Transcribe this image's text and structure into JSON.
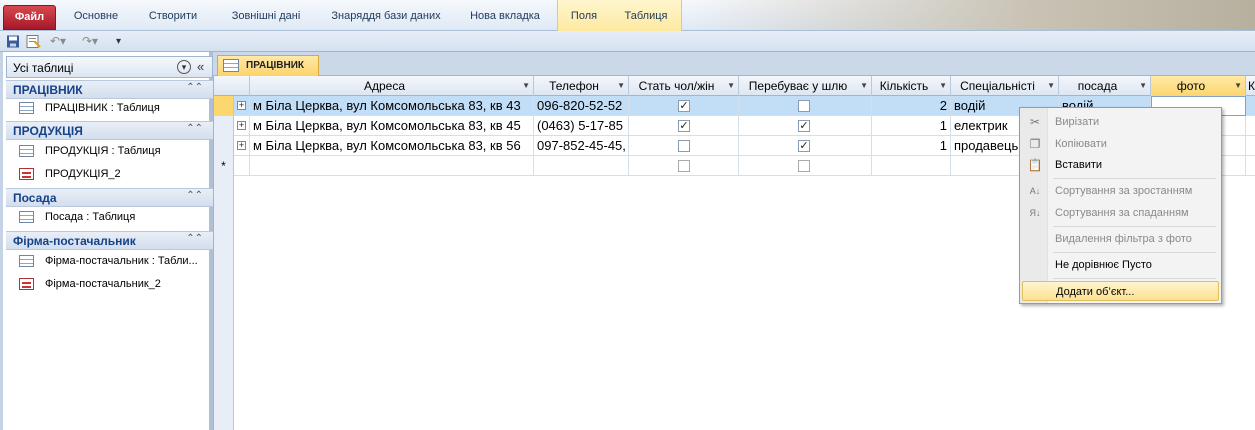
{
  "ribbon": {
    "file_tab": "Файл",
    "tabs": [
      "Основне",
      "Створити",
      "Зовнішні дані",
      "Знаряддя бази даних",
      "Нова вкладка",
      "Поля",
      "Таблиця"
    ]
  },
  "nav": {
    "title": "Усі таблиці",
    "groups": [
      {
        "label": "ПРАЦІВНИК",
        "items": [
          "ПРАЦІВНИК : Таблиця"
        ]
      },
      {
        "label": "ПРОДУКЦІЯ",
        "items": [
          "ПРОДУКЦІЯ : Таблиця",
          "ПРОДУКЦІЯ_2"
        ]
      },
      {
        "label": "Посада",
        "items": [
          "Посада : Таблиця"
        ]
      },
      {
        "label": "Фірма-постачальник",
        "items": [
          "Фірма-постачальник : Табли...",
          "Фірма-постачальник_2"
        ]
      }
    ]
  },
  "document": {
    "tab_label": "ПРАЦІВНИК"
  },
  "table": {
    "columns": [
      "Адреса",
      "Телефон",
      "Стать чол/жін",
      "Перебуває у шлю",
      "Кількість",
      "Спеціальністі",
      "посада",
      "фото",
      "К"
    ],
    "rows": [
      {
        "address": "м Біла Церква, вул Комсомольська 83, кв 43",
        "phone": "096-820-52-52",
        "gender": true,
        "married": false,
        "count": "2",
        "specialty": "водій",
        "position": "водій"
      },
      {
        "address": "м Біла Церква, вул Комсомольська 83, кв 45",
        "phone": "(0463) 5-17-85",
        "gender": true,
        "married": true,
        "count": "1",
        "specialty": "електрик",
        "position": ""
      },
      {
        "address": "м Біла Церква, вул Комсомольська 83, кв 56",
        "phone": "097-852-45-45,",
        "gender": false,
        "married": true,
        "count": "1",
        "specialty": "продавець",
        "position": ""
      }
    ],
    "new_row_marker": "*"
  },
  "context_menu": {
    "items": [
      {
        "label": "Вирізати",
        "icon": "scissors-icon",
        "enabled": false
      },
      {
        "label": "Копіювати",
        "icon": "copy-icon",
        "enabled": false
      },
      {
        "label": "Вставити",
        "icon": "paste-icon",
        "enabled": true
      },
      {
        "label": "Сортування за зростанням",
        "icon": "sort-ascending-icon",
        "enabled": false
      },
      {
        "label": "Сортування за спаданням",
        "icon": "sort-descending-icon",
        "enabled": false
      },
      {
        "label": "Видалення фільтра з фото",
        "icon": "",
        "enabled": false
      },
      {
        "label": "Не дорівнює Пусто",
        "icon": "",
        "enabled": true
      },
      {
        "label": "Додати об’єкт...",
        "icon": "",
        "enabled": true
      }
    ]
  },
  "colors": {
    "file_tab": "#b3202e",
    "selected_row": "#c2ddf6",
    "highlight": "#fde292",
    "group_label": "#15428b"
  }
}
